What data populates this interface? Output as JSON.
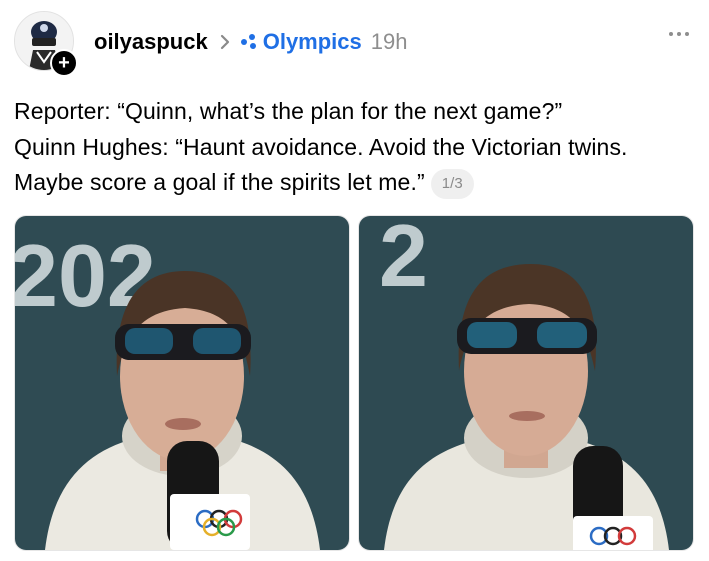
{
  "post": {
    "username": "oilyaspuck",
    "community": "Olympics",
    "time": "19h",
    "lines": [
      "Reporter: “Quinn, what’s the plan for the next game?”",
      "Quinn Hughes: “Haunt avoidance. Avoid the Victorian twins.",
      "Maybe score a goal if the spirits let me.”"
    ],
    "page_indicator": "1/3",
    "photos": [
      {
        "background_text": "202"
      },
      {
        "background_text": "2"
      }
    ]
  },
  "colors": {
    "community_blue": "#1f6fe5",
    "muted_gray": "#8e8e8e",
    "backdrop_teal": "#2f4b53"
  },
  "icons": {
    "avatar": "cartoon-avatar-icon",
    "follow": "plus-icon",
    "separator": "chevron-right-icon",
    "community": "community-dots-icon",
    "more": "more-horizontal-icon"
  }
}
